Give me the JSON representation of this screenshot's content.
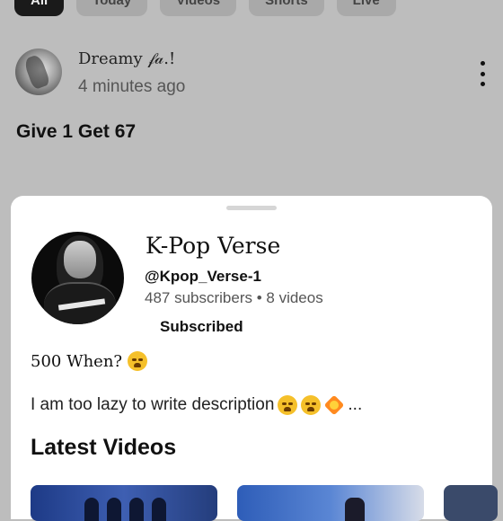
{
  "chips": [
    "All",
    "Today",
    "Videos",
    "Shorts",
    "Live"
  ],
  "post": {
    "author": "Dreamy 𝒻𝒶.!",
    "time": "4 minutes ago",
    "body": "Give 1 Get 67"
  },
  "channel": {
    "name": "K-Pop Verse",
    "handle": "@Kpop_Verse-1",
    "stats": "487 subscribers • 8 videos",
    "subscribe_label": "Subscribed",
    "tagline": "500 When?",
    "description": "I am too lazy to write description",
    "description_suffix": "...",
    "latest_videos_heading": "Latest Videos"
  },
  "colors": {
    "overlay": "#bdbdbd",
    "sheet": "#ffffff",
    "active_chip": "#1a1a1a",
    "thumb_blue": "#2e5db8"
  }
}
